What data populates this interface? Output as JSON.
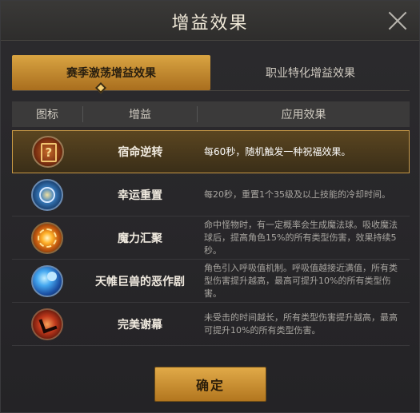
{
  "dialog": {
    "title": "增益效果",
    "close_icon": "close-icon"
  },
  "tabs": [
    {
      "label": "赛季激荡增益效果",
      "active": true
    },
    {
      "label": "职业特化增益效果",
      "active": false
    }
  ],
  "table": {
    "headers": [
      "图标",
      "增益",
      "应用效果"
    ],
    "rows": [
      {
        "icon": "fate-card-icon",
        "name": "宿命逆转",
        "desc": "每60秒，随机触发一种祝福效果。",
        "selected": true
      },
      {
        "icon": "clock-icon",
        "name": "幸运重置",
        "desc": "每20秒，重置1个35级及以上技能的冷却时间。",
        "selected": false
      },
      {
        "icon": "magic-orb-icon",
        "name": "魔力汇聚",
        "desc": "命中怪物时，有一定概率会生成魔法球。吸收魔法球后，提高角色15%的所有类型伤害，效果持续5秒。",
        "selected": false
      },
      {
        "icon": "bubbles-icon",
        "name": "天帷巨兽的恶作剧",
        "desc": "角色引入呼吸值机制。呼吸值越接近满值，所有类型伤害提升越高，最高可提升10%的所有类型伤害。",
        "selected": false
      },
      {
        "icon": "warrior-icon",
        "name": "完美谢幕",
        "desc": "未受击的时间越长，所有类型伤害提升越高，最高可提升10%的所有类型伤害。",
        "selected": false
      }
    ]
  },
  "confirm_label": "确定",
  "colors": {
    "accent": "#d9a442",
    "selected_border": "#c99a45"
  }
}
